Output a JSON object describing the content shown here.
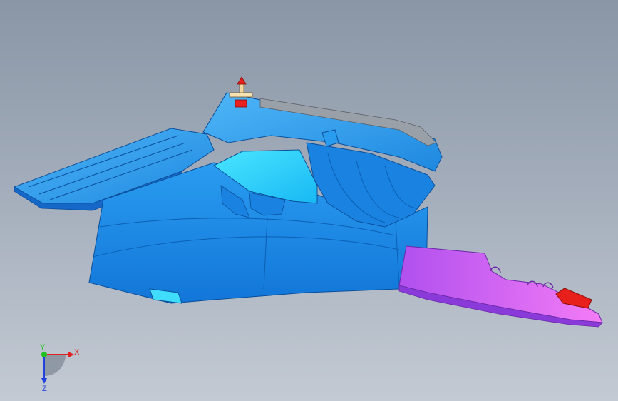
{
  "viewport": {
    "background_top": "#8a96a6",
    "background_bottom": "#c3cad3"
  },
  "model": {
    "main_color": "#1e8fe6",
    "highlight_color": "#3fdcfb",
    "shade_color": "#0f6fd0",
    "bracket_color": "#c05cf0",
    "bracket_light": "#f070f5",
    "tab_color": "#e8201c",
    "gray_strip_color": "#9aa0a8"
  },
  "triad": {
    "x_label": "X",
    "y_label": "Y",
    "z_label": "Z",
    "x_color": "#e02020",
    "y_color": "#20c020",
    "z_color": "#2040e0"
  }
}
